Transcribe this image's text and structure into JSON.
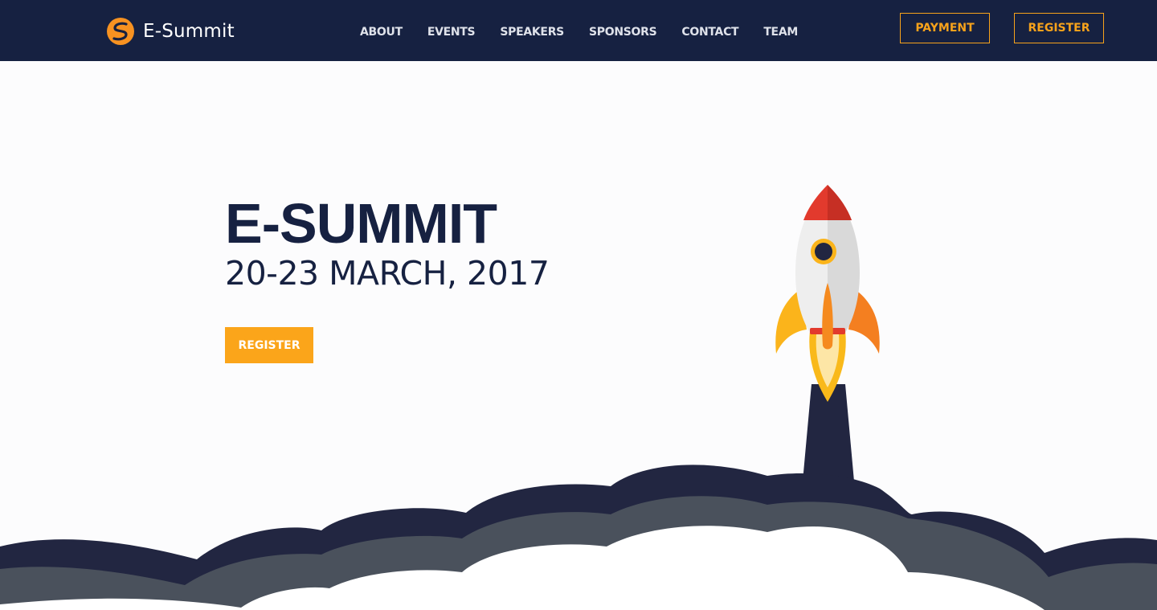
{
  "brand": {
    "name": "E-Summit"
  },
  "nav": {
    "links": [
      "ABOUT",
      "EVENTS",
      "SPEAKERS",
      "SPONSORS",
      "CONTACT",
      "TEAM"
    ],
    "payment_label": "PAYMENT",
    "register_label": "REGISTER"
  },
  "hero": {
    "title": "E-SUMMIT",
    "date": "20-23 MARCH, 2017",
    "cta_label": "REGISTER"
  },
  "colors": {
    "navbar": "#162141",
    "accent": "#f7a21b",
    "cta": "#fba51a",
    "smoke_dark": "#222641",
    "smoke_mid": "#4a515c",
    "background": "#fcfcfd"
  },
  "icons": [
    "logo-icon",
    "rocket-illustration",
    "smoke-cloud-illustration"
  ]
}
